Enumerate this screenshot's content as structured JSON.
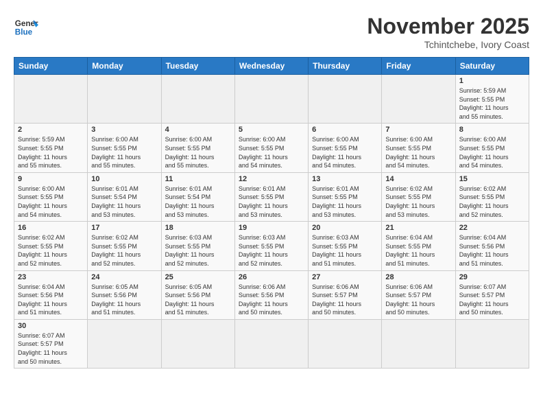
{
  "header": {
    "logo_general": "General",
    "logo_blue": "Blue",
    "month_title": "November 2025",
    "location": "Tchintchebe, Ivory Coast"
  },
  "weekdays": [
    "Sunday",
    "Monday",
    "Tuesday",
    "Wednesday",
    "Thursday",
    "Friday",
    "Saturday"
  ],
  "weeks": [
    [
      {
        "day": "",
        "info": ""
      },
      {
        "day": "",
        "info": ""
      },
      {
        "day": "",
        "info": ""
      },
      {
        "day": "",
        "info": ""
      },
      {
        "day": "",
        "info": ""
      },
      {
        "day": "",
        "info": ""
      },
      {
        "day": "1",
        "info": "Sunrise: 5:59 AM\nSunset: 5:55 PM\nDaylight: 11 hours\nand 55 minutes."
      }
    ],
    [
      {
        "day": "2",
        "info": "Sunrise: 5:59 AM\nSunset: 5:55 PM\nDaylight: 11 hours\nand 55 minutes."
      },
      {
        "day": "3",
        "info": "Sunrise: 6:00 AM\nSunset: 5:55 PM\nDaylight: 11 hours\nand 55 minutes."
      },
      {
        "day": "4",
        "info": "Sunrise: 6:00 AM\nSunset: 5:55 PM\nDaylight: 11 hours\nand 55 minutes."
      },
      {
        "day": "5",
        "info": "Sunrise: 6:00 AM\nSunset: 5:55 PM\nDaylight: 11 hours\nand 54 minutes."
      },
      {
        "day": "6",
        "info": "Sunrise: 6:00 AM\nSunset: 5:55 PM\nDaylight: 11 hours\nand 54 minutes."
      },
      {
        "day": "7",
        "info": "Sunrise: 6:00 AM\nSunset: 5:55 PM\nDaylight: 11 hours\nand 54 minutes."
      },
      {
        "day": "8",
        "info": "Sunrise: 6:00 AM\nSunset: 5:55 PM\nDaylight: 11 hours\nand 54 minutes."
      }
    ],
    [
      {
        "day": "9",
        "info": "Sunrise: 6:00 AM\nSunset: 5:55 PM\nDaylight: 11 hours\nand 54 minutes."
      },
      {
        "day": "10",
        "info": "Sunrise: 6:01 AM\nSunset: 5:54 PM\nDaylight: 11 hours\nand 53 minutes."
      },
      {
        "day": "11",
        "info": "Sunrise: 6:01 AM\nSunset: 5:54 PM\nDaylight: 11 hours\nand 53 minutes."
      },
      {
        "day": "12",
        "info": "Sunrise: 6:01 AM\nSunset: 5:55 PM\nDaylight: 11 hours\nand 53 minutes."
      },
      {
        "day": "13",
        "info": "Sunrise: 6:01 AM\nSunset: 5:55 PM\nDaylight: 11 hours\nand 53 minutes."
      },
      {
        "day": "14",
        "info": "Sunrise: 6:02 AM\nSunset: 5:55 PM\nDaylight: 11 hours\nand 53 minutes."
      },
      {
        "day": "15",
        "info": "Sunrise: 6:02 AM\nSunset: 5:55 PM\nDaylight: 11 hours\nand 52 minutes."
      }
    ],
    [
      {
        "day": "16",
        "info": "Sunrise: 6:02 AM\nSunset: 5:55 PM\nDaylight: 11 hours\nand 52 minutes."
      },
      {
        "day": "17",
        "info": "Sunrise: 6:02 AM\nSunset: 5:55 PM\nDaylight: 11 hours\nand 52 minutes."
      },
      {
        "day": "18",
        "info": "Sunrise: 6:03 AM\nSunset: 5:55 PM\nDaylight: 11 hours\nand 52 minutes."
      },
      {
        "day": "19",
        "info": "Sunrise: 6:03 AM\nSunset: 5:55 PM\nDaylight: 11 hours\nand 52 minutes."
      },
      {
        "day": "20",
        "info": "Sunrise: 6:03 AM\nSunset: 5:55 PM\nDaylight: 11 hours\nand 51 minutes."
      },
      {
        "day": "21",
        "info": "Sunrise: 6:04 AM\nSunset: 5:55 PM\nDaylight: 11 hours\nand 51 minutes."
      },
      {
        "day": "22",
        "info": "Sunrise: 6:04 AM\nSunset: 5:56 PM\nDaylight: 11 hours\nand 51 minutes."
      }
    ],
    [
      {
        "day": "23",
        "info": "Sunrise: 6:04 AM\nSunset: 5:56 PM\nDaylight: 11 hours\nand 51 minutes."
      },
      {
        "day": "24",
        "info": "Sunrise: 6:05 AM\nSunset: 5:56 PM\nDaylight: 11 hours\nand 51 minutes."
      },
      {
        "day": "25",
        "info": "Sunrise: 6:05 AM\nSunset: 5:56 PM\nDaylight: 11 hours\nand 51 minutes."
      },
      {
        "day": "26",
        "info": "Sunrise: 6:06 AM\nSunset: 5:56 PM\nDaylight: 11 hours\nand 50 minutes."
      },
      {
        "day": "27",
        "info": "Sunrise: 6:06 AM\nSunset: 5:57 PM\nDaylight: 11 hours\nand 50 minutes."
      },
      {
        "day": "28",
        "info": "Sunrise: 6:06 AM\nSunset: 5:57 PM\nDaylight: 11 hours\nand 50 minutes."
      },
      {
        "day": "29",
        "info": "Sunrise: 6:07 AM\nSunset: 5:57 PM\nDaylight: 11 hours\nand 50 minutes."
      }
    ],
    [
      {
        "day": "30",
        "info": "Sunrise: 6:07 AM\nSunset: 5:57 PM\nDaylight: 11 hours\nand 50 minutes."
      },
      {
        "day": "",
        "info": ""
      },
      {
        "day": "",
        "info": ""
      },
      {
        "day": "",
        "info": ""
      },
      {
        "day": "",
        "info": ""
      },
      {
        "day": "",
        "info": ""
      },
      {
        "day": "",
        "info": ""
      }
    ]
  ]
}
